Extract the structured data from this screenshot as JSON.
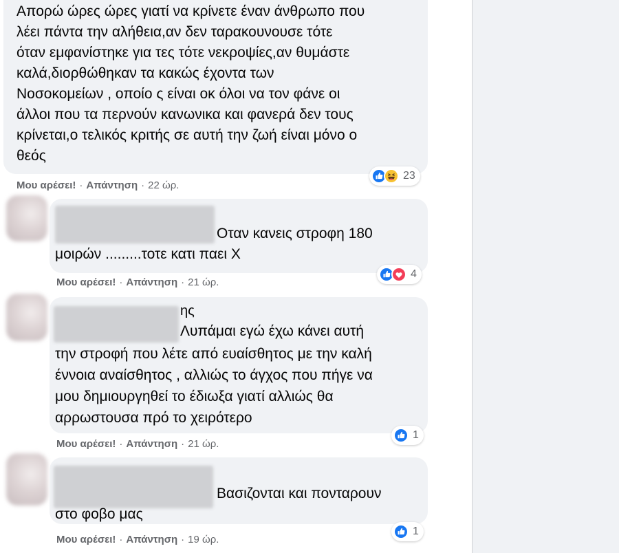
{
  "colors": {
    "bubble": "#f0f2f5",
    "text": "#050505",
    "secondary": "#65676b",
    "like_blue": "#1877f2",
    "panel": "#f0f2f5"
  },
  "separator": "·",
  "comments": [
    {
      "lines": [
        "Απορώ ώρες ώρες γιατί να κρίνετε έναν άνθρωπο που",
        "λέει πάντα την αλήθεια,αν δεν ταρακουνουσε τότε",
        "όταν εμφανίστηκε για τες τότε νεκροψίες,αν θυμάστε",
        "καλά,διορθώθηκαν τα κακώς έχοντα των",
        "Νοσοκομείων , οποίο ς είναι οκ όλοι να τον φάνε οι",
        "άλλοι που τα περνούν κανωνικα και φανερά δεν τους",
        "κρίνεται,ο τελικός κριτής σε αυτή την ζωή είναι μόνο ο",
        "θεός"
      ],
      "reactions": {
        "icons": [
          "like-icon",
          "haha-icon"
        ],
        "count": "23"
      },
      "actions": {
        "like": "Μου αρέσει!",
        "reply": "Απάντηση",
        "time": "22 ώρ."
      }
    },
    {
      "lines": [
        "Οταν κανεις στροφη 180",
        "μοιρών .........τοτε κατι παει Χ"
      ],
      "reactions": {
        "icons": [
          "like-icon",
          "love-icon"
        ],
        "count": "4"
      },
      "actions": {
        "like": "Μου αρέσει!",
        "reply": "Απάντηση",
        "time": "21 ώρ."
      }
    },
    {
      "author_name_fragment": "ης",
      "lines": [
        "Λυπάμαι εγώ έχω κάνει αυτή",
        "την στροφή που λέτε από ευαίσθητος με την καλή",
        "έννοια αναίσθητος , αλλιώς το άγχος που πήγε να",
        "μου δημιουργηθεί το έδιωξα γιατί αλλιώς θα",
        "αρρωστουσα πρό το χειρότερο"
      ],
      "reactions": {
        "icons": [
          "like-icon"
        ],
        "count": "1"
      },
      "actions": {
        "like": "Μου αρέσει!",
        "reply": "Απάντηση",
        "time": "21 ώρ."
      }
    },
    {
      "lines": [
        "Βασιζονται και πονταρουν",
        "στο φοβο μας"
      ],
      "reactions": {
        "icons": [
          "like-icon"
        ],
        "count": "1"
      },
      "actions": {
        "like": "Μου αρέσει!",
        "reply": "Απάντηση",
        "time": "19 ώρ."
      }
    }
  ]
}
